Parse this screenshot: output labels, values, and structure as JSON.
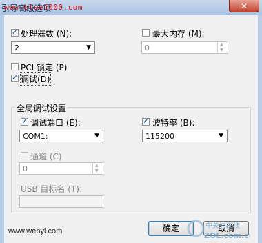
{
  "window": {
    "title_partial": "引导高级选项",
    "watermark_top": "www.blue1000.com",
    "close_symbol": "✕"
  },
  "processor": {
    "label": "处理器数 (N):",
    "checked": true,
    "value": "2"
  },
  "max_memory": {
    "label": "最大内存 (M):",
    "checked": false,
    "value": "0"
  },
  "pci_lock": {
    "label": "PCI 锁定 (P)",
    "checked": false
  },
  "debug": {
    "label": "调试(D)",
    "checked": true
  },
  "global_debug": {
    "group_title": "全局调试设置",
    "debug_port": {
      "label": "调试端口 (E):",
      "checked": true,
      "value": "COM1:"
    },
    "baud_rate": {
      "label": "波特率 (B):",
      "checked": true,
      "value": "115200"
    },
    "channel": {
      "label": "通道 (C)",
      "checked": false,
      "value": "0"
    },
    "usb_target": {
      "label": "USB 目标名 (T):",
      "value": ""
    }
  },
  "buttons": {
    "ok": "确定",
    "cancel": "取消"
  },
  "watermark_bottom": "www.webyi.com",
  "logo_text": "中关村在线",
  "logo_sub": "ZOL.com.cn",
  "colors": {
    "titlebar": "#a9c2e3",
    "close": "#c4422f",
    "watermark_red": "#d01010",
    "check_mark": "#1c3c78"
  },
  "icons": {
    "check": "✓",
    "dropdown": "▼",
    "spin_up": "▲",
    "spin_down": "▼"
  }
}
